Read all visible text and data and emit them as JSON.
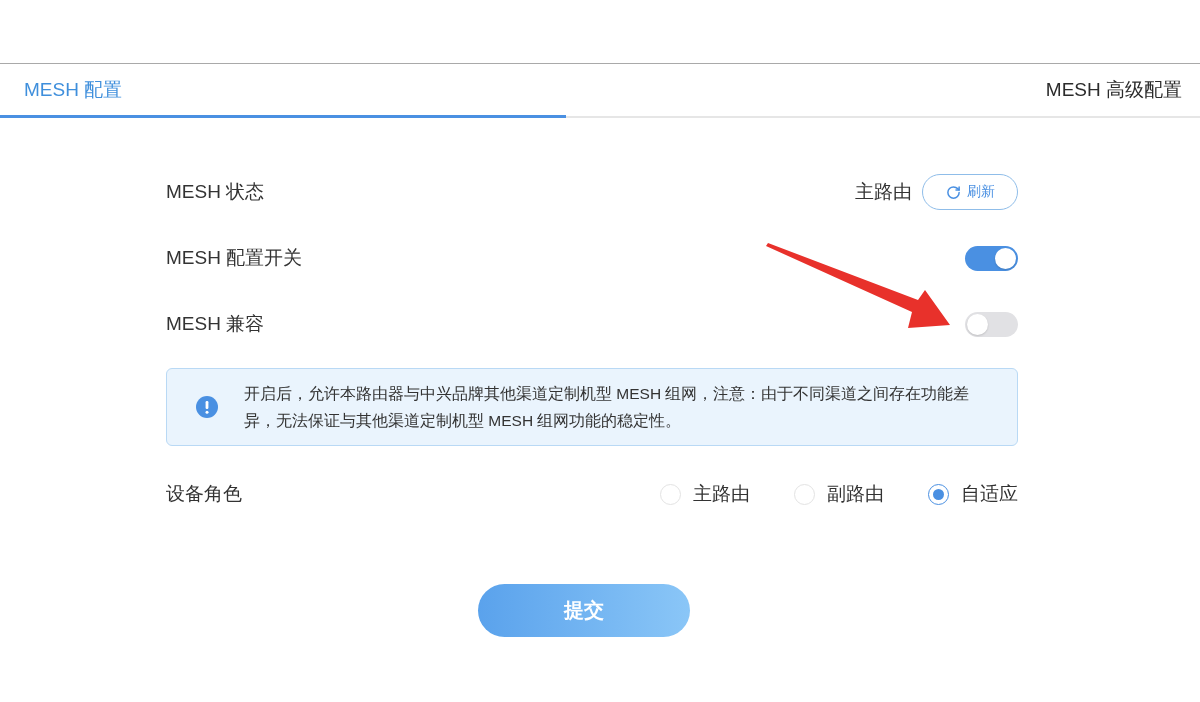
{
  "tabs": [
    {
      "label": "MESH 配置",
      "selected": true
    },
    {
      "label": "MESH 高级配置",
      "selected": false
    }
  ],
  "settings": [
    {
      "kind": "status",
      "label": "MESH 状态",
      "value": "主路由",
      "button": "刷新"
    },
    {
      "kind": "switch",
      "label": "MESH 配置开关",
      "on": true
    },
    {
      "kind": "switch",
      "label": "MESH 兼容",
      "on": false
    }
  ],
  "notice": {
    "text": "开启后，允许本路由器与中兴品牌其他渠道定制机型 MESH 组网，注意：由于不同渠道之间存在功能差异，无法保证与其他渠道定制机型 MESH 组网功能的稳定性。"
  },
  "role": {
    "label": "设备角色",
    "options": [
      {
        "label": "主路由",
        "selected": false
      },
      {
        "label": "副路由",
        "selected": false
      },
      {
        "label": "自适应",
        "selected": true
      }
    ]
  },
  "submit": {
    "label": "提交"
  }
}
